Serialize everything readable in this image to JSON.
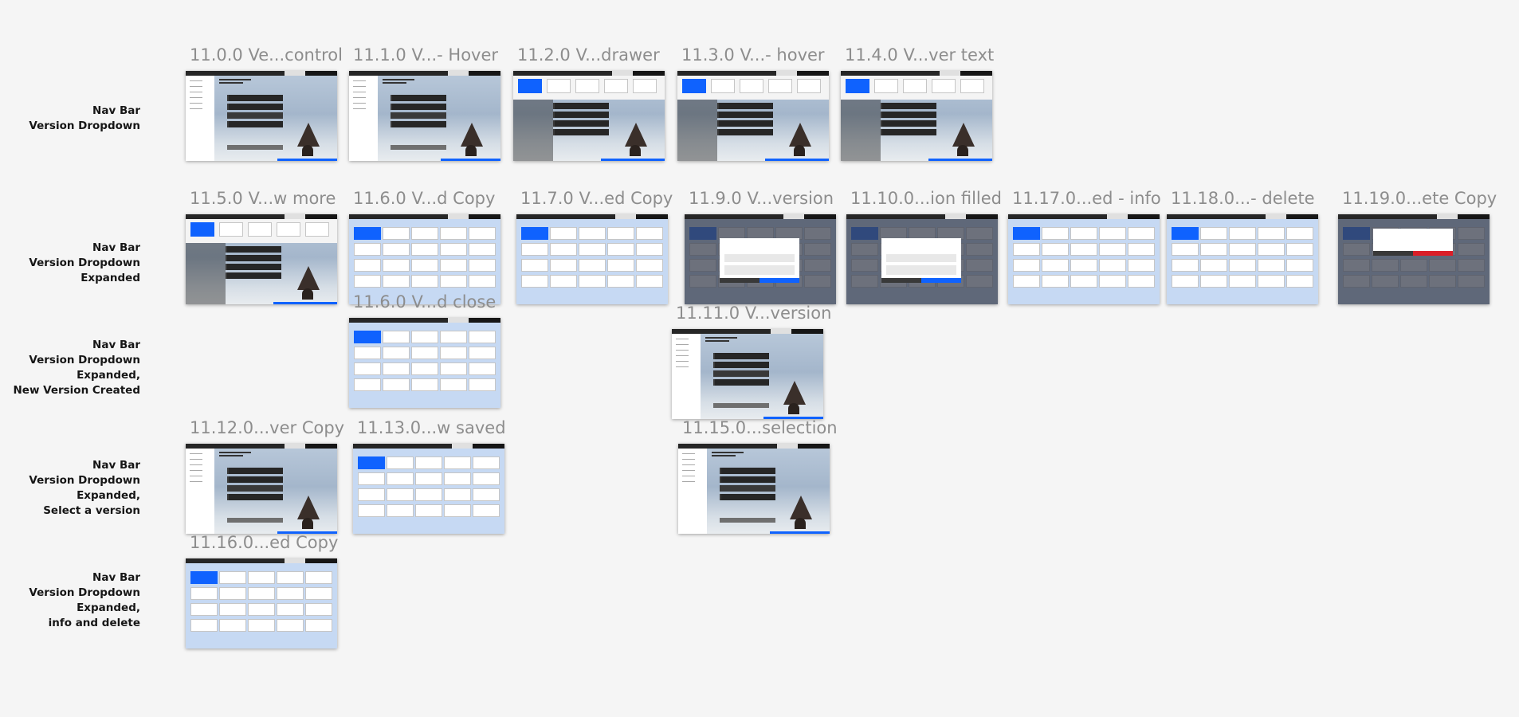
{
  "row_labels": [
    {
      "id": "row-1",
      "lines": [
        "Nav Bar",
        "Version Dropdown"
      ]
    },
    {
      "id": "row-2",
      "lines": [
        "Nav Bar",
        "Version Dropdown",
        "Expanded"
      ]
    },
    {
      "id": "row-3",
      "lines": [
        "Nav Bar",
        "Version Dropdown",
        "Expanded,",
        "New Version Created"
      ]
    },
    {
      "id": "row-4",
      "lines": [
        "Nav Bar",
        "Version Dropdown",
        "Expanded,",
        "Select a version"
      ]
    },
    {
      "id": "row-5",
      "lines": [
        "Nav Bar",
        "Version Dropdown",
        "Expanded,",
        "info and delete"
      ]
    }
  ],
  "artboards": [
    {
      "id": "a0",
      "title": "11.0.0 Ve...control",
      "kind": "home"
    },
    {
      "id": "a1",
      "title": "11.1.0 V...- Hover",
      "kind": "home"
    },
    {
      "id": "a2",
      "title": "11.2.0 V...drawer",
      "kind": "drawer"
    },
    {
      "id": "a3",
      "title": "11.3.0 V...- hover",
      "kind": "drawer"
    },
    {
      "id": "a4",
      "title": "11.4.0 V...ver text",
      "kind": "drawer"
    },
    {
      "id": "a5",
      "title": "11.5.0 V...w more",
      "kind": "drawer"
    },
    {
      "id": "a6",
      "title": "11.6.0 V...d Copy",
      "kind": "grid"
    },
    {
      "id": "a7",
      "title": "11.7.0 V...ed Copy",
      "kind": "grid"
    },
    {
      "id": "a8",
      "title": "11.9.0 V...version",
      "kind": "modal"
    },
    {
      "id": "a9",
      "title": "11.10.0...ion filled",
      "kind": "modal"
    },
    {
      "id": "a10",
      "title": "11.17.0...ed - info",
      "kind": "grid"
    },
    {
      "id": "a11",
      "title": "11.18.0...- delete",
      "kind": "grid"
    },
    {
      "id": "a12",
      "title": "11.19.0...ete Copy",
      "kind": "delete"
    },
    {
      "id": "a13",
      "title": "11.6.0 V...d close",
      "kind": "grid"
    },
    {
      "id": "a14",
      "title": "11.11.0 V...version",
      "kind": "home"
    },
    {
      "id": "a15",
      "title": "11.12.0...ver Copy",
      "kind": "home"
    },
    {
      "id": "a16",
      "title": "11.13.0...w saved",
      "kind": "grid"
    },
    {
      "id": "a17",
      "title": "11.15.0...selection",
      "kind": "home"
    },
    {
      "id": "a18",
      "title": "11.16.0...ed Copy",
      "kind": "grid"
    }
  ],
  "colors": {
    "background": "#f5f5f5",
    "accent": "#0f62fe",
    "danger": "#da1e28",
    "topbar": "#262626",
    "light_blue": "#c6d9f3",
    "label_text": "#161616",
    "title_text": "#8d8d8d"
  }
}
